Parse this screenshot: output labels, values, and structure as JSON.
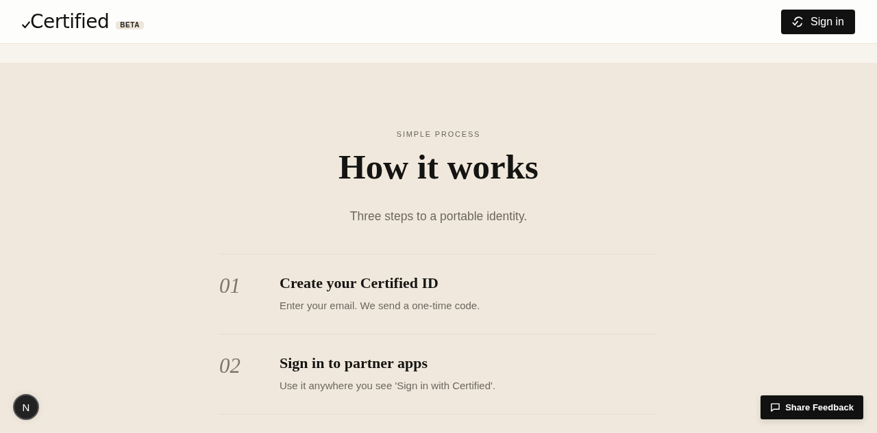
{
  "header": {
    "logo": {
      "text": "Certified",
      "badge": "BETA"
    },
    "sign_in_button": "Sign in"
  },
  "section": {
    "eyebrow": "SIMPLE PROCESS",
    "title": "How it works",
    "subtitle": "Three steps to a portable identity.",
    "steps": [
      {
        "number": "01",
        "title": "Create your Certified ID",
        "description": "Enter your email. We send a one-time code."
      },
      {
        "number": "02",
        "title": "Sign in to partner apps",
        "description": "Use it anywhere you see 'Sign in with Certified'."
      }
    ]
  },
  "dev_indicator": "N",
  "feedback_button": "Share Feedback"
}
